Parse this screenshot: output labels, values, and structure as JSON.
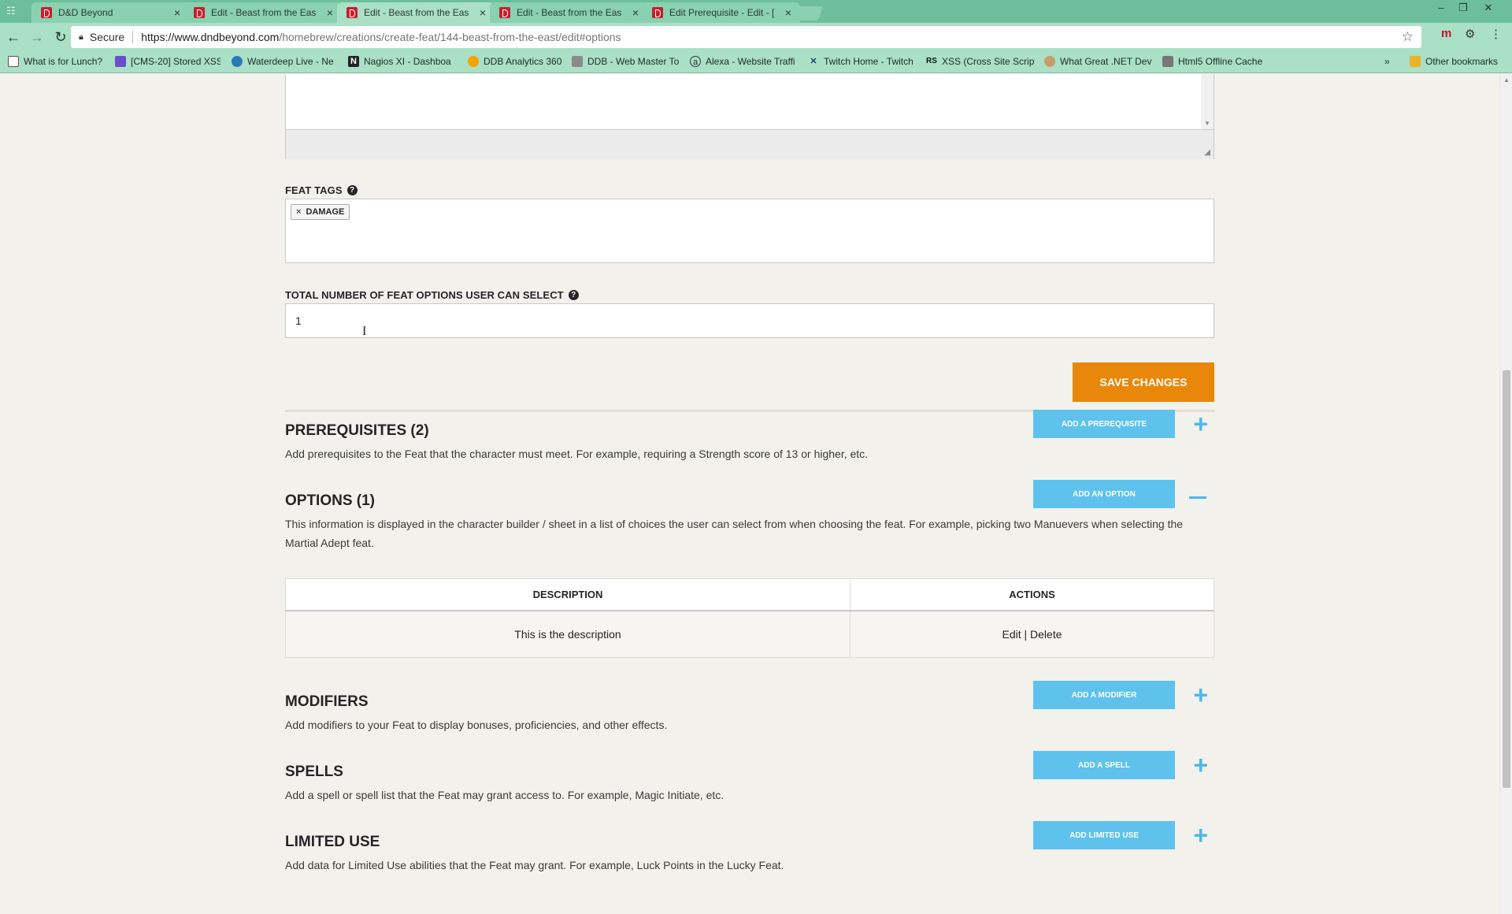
{
  "browser": {
    "tabs": [
      {
        "label": "D&D Beyond",
        "active": false
      },
      {
        "label": "Edit - Beast from the Eas",
        "active": false
      },
      {
        "label": "Edit - Beast from the Eas",
        "active": true
      },
      {
        "label": "Edit - Beast from the Eas",
        "active": false
      },
      {
        "label": "Edit Prerequisite - Edit - [",
        "active": false
      }
    ],
    "secure_label": "Secure",
    "url_host": "https://www.dndbeyond.com",
    "url_path": "/homebrew/creations/create-feat/144-beast-from-the-east/edit#options",
    "bookmarks": [
      "What is for Lunch?",
      "[CMS-20] Stored XSS",
      "Waterdeep Live - Ne",
      "Nagios XI - Dashboa",
      "DDB Analytics 360",
      "DDB - Web Master To",
      "Alexa - Website Traffi",
      "Twitch Home - Twitch",
      "XSS (Cross Site Script",
      "What Great .NET Dev",
      "Html5 Offline Cache",
      "Other bookmarks"
    ],
    "overflow_glyph": "»"
  },
  "feat_tags": {
    "label": "Feat Tags",
    "tags": [
      "DAMAGE"
    ]
  },
  "options_count": {
    "label": "Total Number of Feat Options User Can Select",
    "value": "1"
  },
  "save_label": "Save Changes",
  "sections": {
    "prerequisites": {
      "title": "Prerequisites (2)",
      "desc": "Add prerequisites to the Feat that the character must meet. For example, requiring a Strength score of 13 or higher, etc.",
      "button": "Add a Prerequisite"
    },
    "options": {
      "title": "Options (1)",
      "desc": "This information is displayed in the character builder / sheet in a list of choices the user can select from when choosing the feat. For example, picking two Manuevers when selecting the Martial Adept feat.",
      "button": "Add an Option",
      "table": {
        "headers": [
          "Description",
          "Actions"
        ],
        "rows": [
          {
            "description": "This is the description",
            "edit": "Edit",
            "sep": "|",
            "delete": "Delete"
          }
        ]
      }
    },
    "modifiers": {
      "title": "Modifiers",
      "desc": "Add modifiers to your Feat to display bonuses, proficiencies, and other effects.",
      "button": "Add a Modifier"
    },
    "spells": {
      "title": "Spells",
      "desc": "Add a spell or spell list that the Feat may grant access to. For example, Magic Initiate, etc.",
      "button": "Add a Spell"
    },
    "limited_use": {
      "title": "Limited Use",
      "desc": "Add data for Limited Use abilities that the Feat may grant. For example, Luck Points in the Lucky Feat.",
      "button": "Add Limited Use"
    }
  }
}
